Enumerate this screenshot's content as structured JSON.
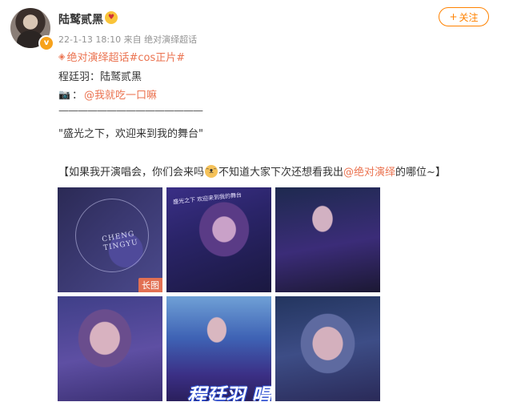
{
  "post": {
    "username": "陆鹫贰黑",
    "username_emoji": "😍",
    "timestamp": "22-1-13 18:10",
    "source_prefix": "来自",
    "source": "绝对演绎超话",
    "follow_label": "关注",
    "follow_icon": "plus-icon",
    "topic_icon": "diamond-icon",
    "topic": "绝对演绎超话#cos正片#",
    "role_line": "程廷羽：陆鹫贰黑",
    "camera_icon": "camera-icon",
    "photographer_prefix": "：",
    "photographer": "@我就吃一口嘛",
    "divider": "———————————————",
    "quote": "\"盛光之下，欢迎来到我的舞台\"",
    "question_pre": "【如果我开演唱会，你们会来吗",
    "question_mid": "不知道大家下次还想看我出",
    "question_mention": "@绝对演绎",
    "question_post": " 的哪位~】",
    "emoji_icon": "cat-emoji-icon"
  },
  "images": [
    {
      "name": "photo-1",
      "overlay_text": "CHENG TINGYU",
      "badge": "长图"
    },
    {
      "name": "photo-2",
      "overlay_text": "盛光之下 欢迎来到我的舞台"
    },
    {
      "name": "photo-3"
    },
    {
      "name": "photo-4"
    },
    {
      "name": "photo-5",
      "overlay_text": "程廷羽 唱会"
    },
    {
      "name": "photo-6"
    }
  ],
  "colors": {
    "accent": "#eb7350",
    "follow": "#ff8200",
    "meta": "#939393"
  }
}
